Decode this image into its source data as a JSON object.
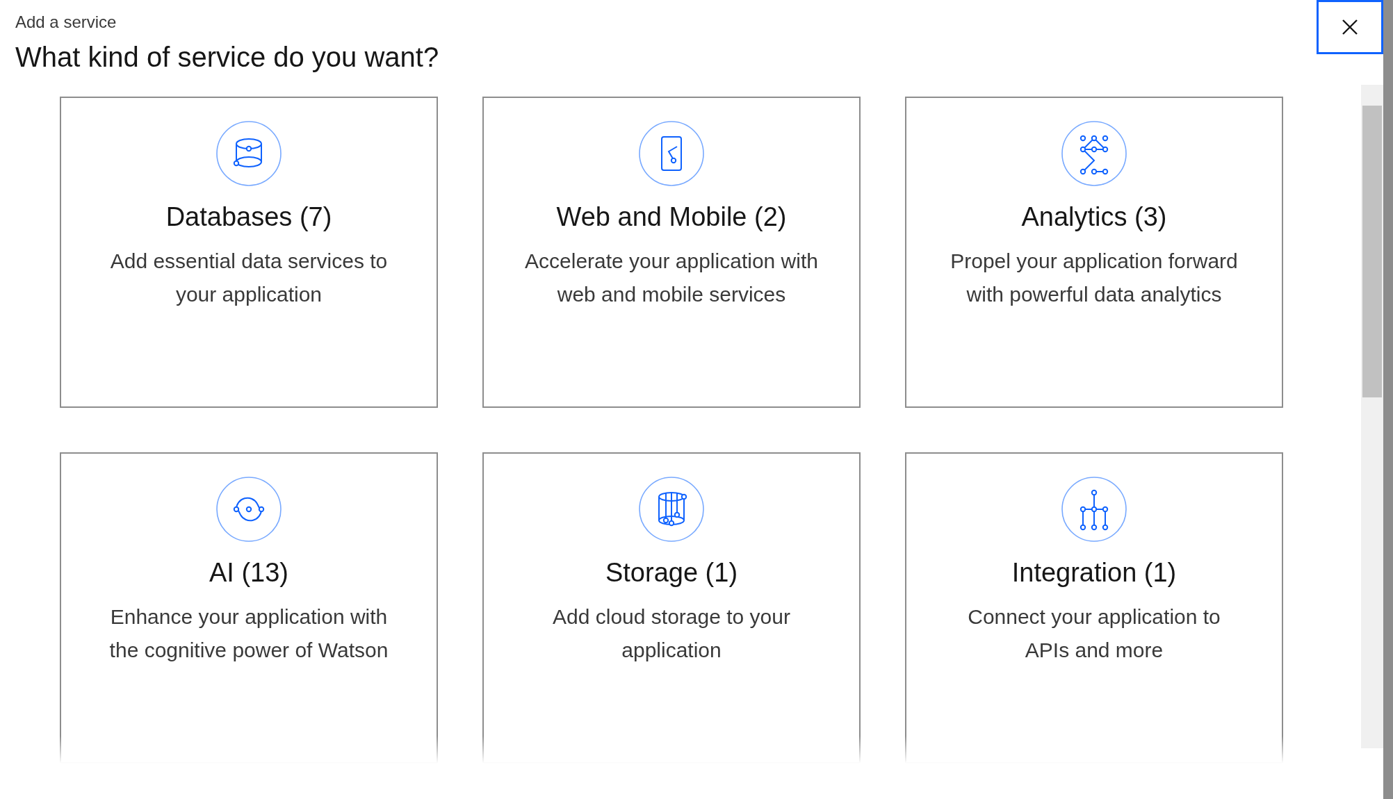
{
  "dialog": {
    "label": "Add a service",
    "title": "What kind of service do you want?"
  },
  "categories": [
    {
      "title": "Databases (7)",
      "description": "Add essential data services to your application"
    },
    {
      "title": "Web and Mobile (2)",
      "description": "Accelerate your application with web and mobile services"
    },
    {
      "title": "Analytics (3)",
      "description": "Propel your application forward with powerful data analytics"
    },
    {
      "title": "AI (13)",
      "description": "Enhance your application with the cognitive power of Watson"
    },
    {
      "title": "Storage (1)",
      "description": "Add cloud storage to your application"
    },
    {
      "title": "Integration (1)",
      "description": "Connect your application to APIs and more"
    }
  ]
}
